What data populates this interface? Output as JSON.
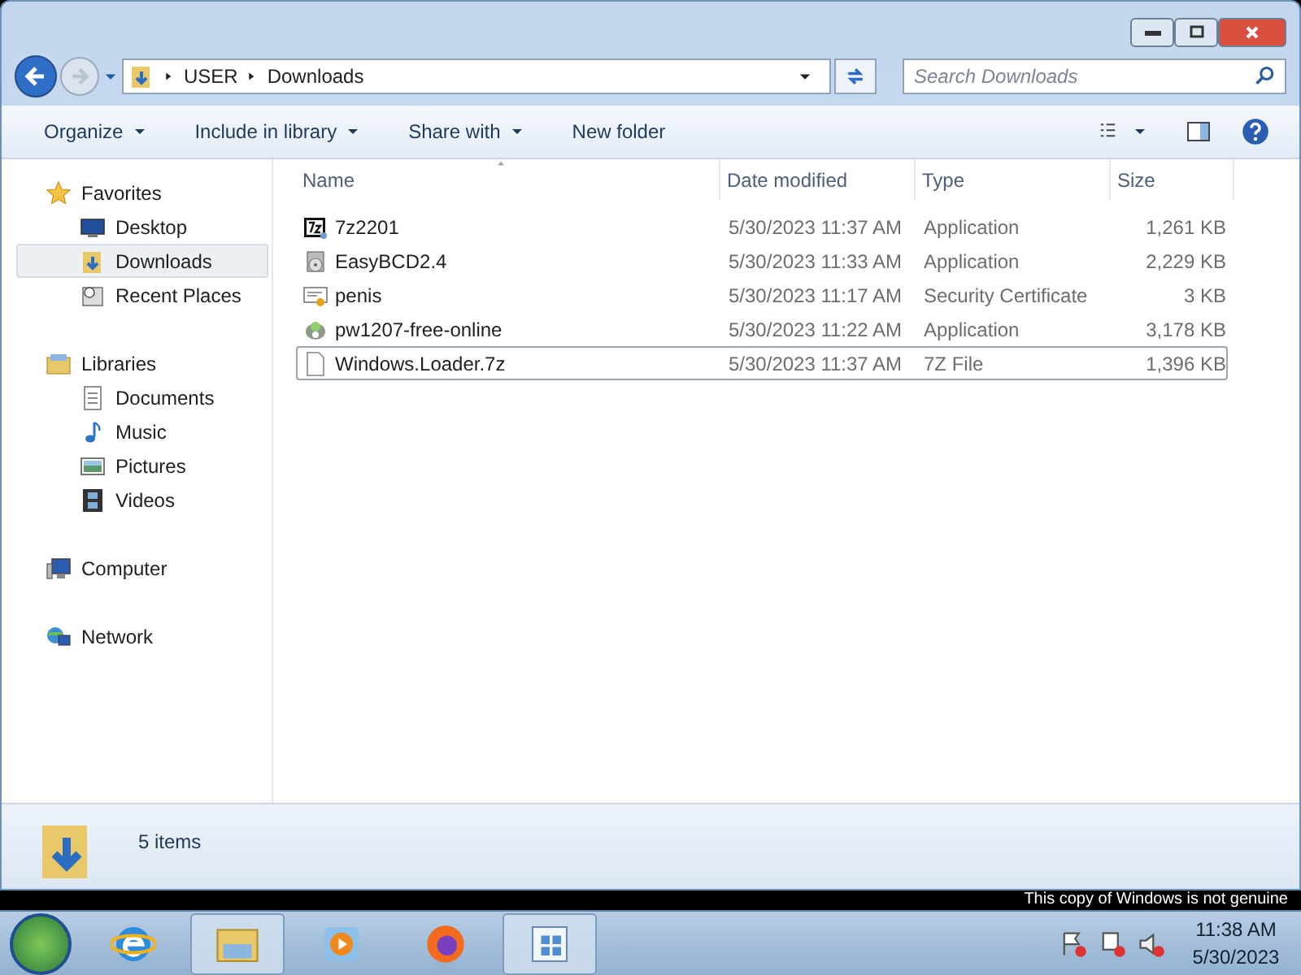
{
  "address": {
    "breadcrumbs": [
      "USER",
      "Downloads"
    ]
  },
  "search": {
    "placeholder": "Search Downloads"
  },
  "toolbar": [
    {
      "label": "Organize",
      "dropdown": true
    },
    {
      "label": "Include in library",
      "dropdown": true
    },
    {
      "label": "Share with",
      "dropdown": true
    },
    {
      "label": "New folder",
      "dropdown": false
    }
  ],
  "sidebar": {
    "groups": [
      {
        "label": "Favorites",
        "kind": "star",
        "items": [
          {
            "label": "Desktop",
            "kind": "desktop",
            "selected": false
          },
          {
            "label": "Downloads",
            "kind": "downloads",
            "selected": true
          },
          {
            "label": "Recent Places",
            "kind": "recent",
            "selected": false
          }
        ]
      },
      {
        "label": "Libraries",
        "kind": "library",
        "items": [
          {
            "label": "Documents",
            "kind": "document",
            "selected": false
          },
          {
            "label": "Music",
            "kind": "music",
            "selected": false
          },
          {
            "label": "Pictures",
            "kind": "picture",
            "selected": false
          },
          {
            "label": "Videos",
            "kind": "video",
            "selected": false
          }
        ]
      },
      {
        "label": "Computer",
        "kind": "computer"
      },
      {
        "label": "Network",
        "kind": "network"
      }
    ]
  },
  "table": {
    "columns": [
      "Name",
      "Date modified",
      "Type",
      "Size"
    ],
    "rows": [
      {
        "kind": "sevenzip",
        "name": "7z2201",
        "date": "5/30/2023 11:37 AM",
        "type": "Application",
        "size": "1,261 KB",
        "focused": false
      },
      {
        "kind": "installer",
        "name": "EasyBCD2.4",
        "date": "5/30/2023 11:33 AM",
        "type": "Application",
        "size": "2,229 KB",
        "focused": false
      },
      {
        "kind": "certificate",
        "name": "penis",
        "date": "5/30/2023 11:17 AM",
        "type": "Security Certificate",
        "size": "3 KB",
        "focused": false
      },
      {
        "kind": "setup",
        "name": "pw1207-free-online",
        "date": "5/30/2023 11:22 AM",
        "type": "Application",
        "size": "3,178 KB",
        "focused": false
      },
      {
        "kind": "file",
        "name": "Windows.Loader.7z",
        "date": "5/30/2023 11:37 AM",
        "type": "7Z File",
        "size": "1,396 KB",
        "focused": true
      }
    ]
  },
  "status": {
    "count": "5 items"
  },
  "desktop_notice": "This copy of Windows is not genuine",
  "taskbar": {
    "apps": [
      {
        "kind": "ie",
        "active": false
      },
      {
        "kind": "explorer",
        "active": true
      },
      {
        "kind": "media",
        "active": false
      },
      {
        "kind": "firefox",
        "active": false
      },
      {
        "kind": "update",
        "active": true
      }
    ],
    "clock": {
      "time": "11:38 AM",
      "date": "5/30/2023"
    }
  }
}
